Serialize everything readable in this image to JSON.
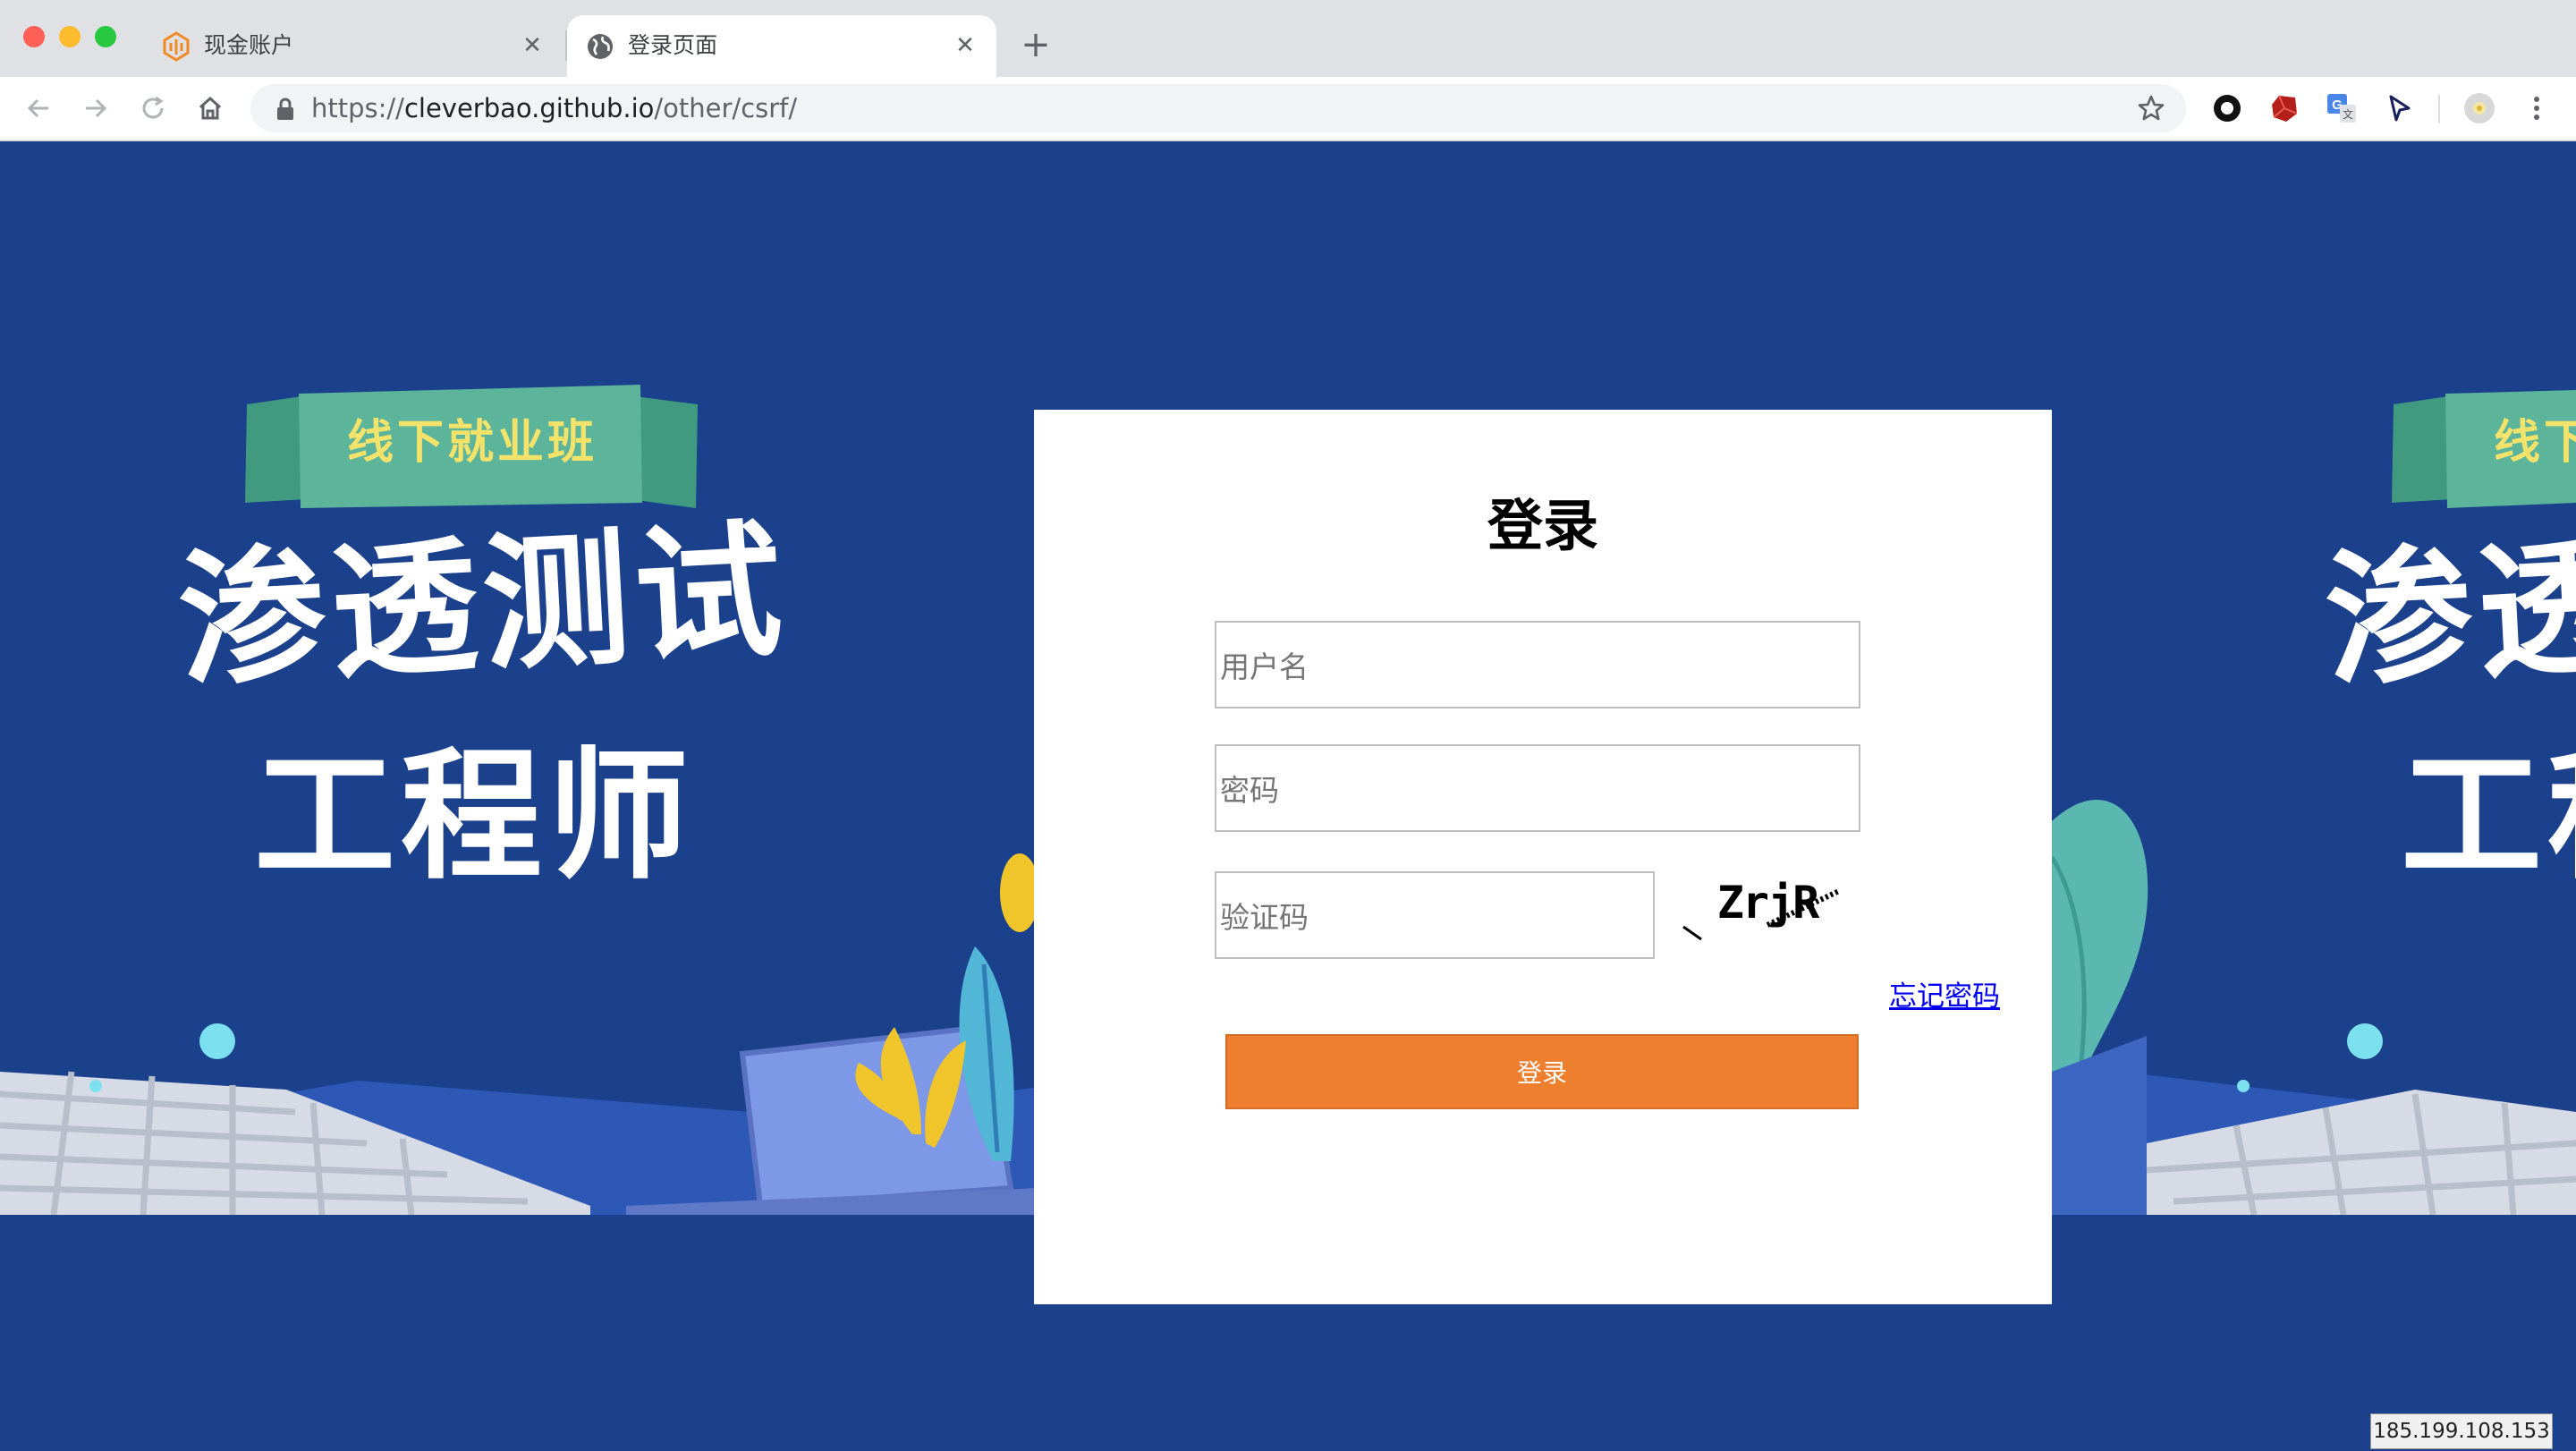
{
  "tabs": [
    {
      "title": "现金账户",
      "favicon": "brand-logo-icon",
      "active": false
    },
    {
      "title": "登录页面",
      "favicon": "globe-icon",
      "active": true
    }
  ],
  "address": {
    "scheme": "https://",
    "host": "cleverbao.github.io",
    "path": "/other/csrf/"
  },
  "banner": {
    "ribbon": "线下就业班",
    "headline_line1": "渗透测试",
    "headline_line2": "工程师"
  },
  "login": {
    "title": "登录",
    "username_placeholder": "用户名",
    "password_placeholder": "密码",
    "captcha_placeholder": "验证码",
    "captcha_text": "ZrjR",
    "forgot_label": "忘记密码",
    "submit_label": "登录"
  },
  "ip_label": "185.199.108.153",
  "colors": {
    "page_bg": "#1b408c",
    "button": "#ee7f2f",
    "ribbon": "#3f9a80",
    "ribbon_text": "#f3e36a",
    "link": "#0000ee"
  }
}
